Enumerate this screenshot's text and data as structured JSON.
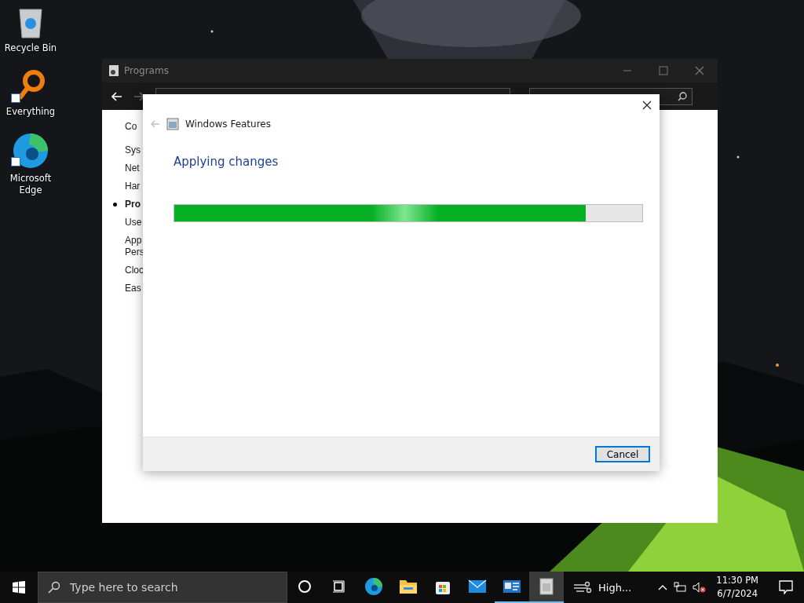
{
  "desktop": {
    "icons": [
      {
        "label": "Recycle Bin",
        "kind": "recycle",
        "shortcut": false
      },
      {
        "label": "Everything",
        "kind": "magnifier",
        "shortcut": true
      },
      {
        "label": "Microsoft Edge",
        "kind": "edge",
        "shortcut": true
      }
    ]
  },
  "control_panel": {
    "title": "Programs",
    "sidebar": [
      {
        "label": "Co",
        "selected": false
      },
      {
        "label": "Sys",
        "selected": false
      },
      {
        "label": "Net",
        "selected": false
      },
      {
        "label": "Har",
        "selected": false
      },
      {
        "label": "Pro",
        "selected": true
      },
      {
        "label": "Use",
        "selected": false
      },
      {
        "label": "App\nPers",
        "selected": false
      },
      {
        "label": "Cloc",
        "selected": false
      },
      {
        "label": "Eas",
        "selected": false
      }
    ]
  },
  "dialog": {
    "title": "Windows Features",
    "heading": "Applying changes",
    "progress": {
      "level": 0.88
    },
    "buttons": [
      "Cancel"
    ]
  },
  "taskbar": {
    "search": {
      "placeholder": "Type here to search"
    },
    "apps": [
      {
        "kind": "cortana",
        "running": false,
        "selected": false
      },
      {
        "kind": "taskview",
        "running": false,
        "selected": false
      },
      {
        "kind": "edge",
        "running": false,
        "selected": false
      },
      {
        "kind": "explorer",
        "running": false,
        "selected": false
      },
      {
        "kind": "store",
        "running": false,
        "selected": false
      },
      {
        "kind": "mail",
        "running": false,
        "selected": false
      },
      {
        "kind": "controlpanel",
        "running": true,
        "selected": false
      },
      {
        "kind": "features",
        "running": true,
        "selected": true
      }
    ],
    "weather": "High...",
    "time": "11:30 PM",
    "date": "6/7/2024",
    "volume_muted": true
  }
}
